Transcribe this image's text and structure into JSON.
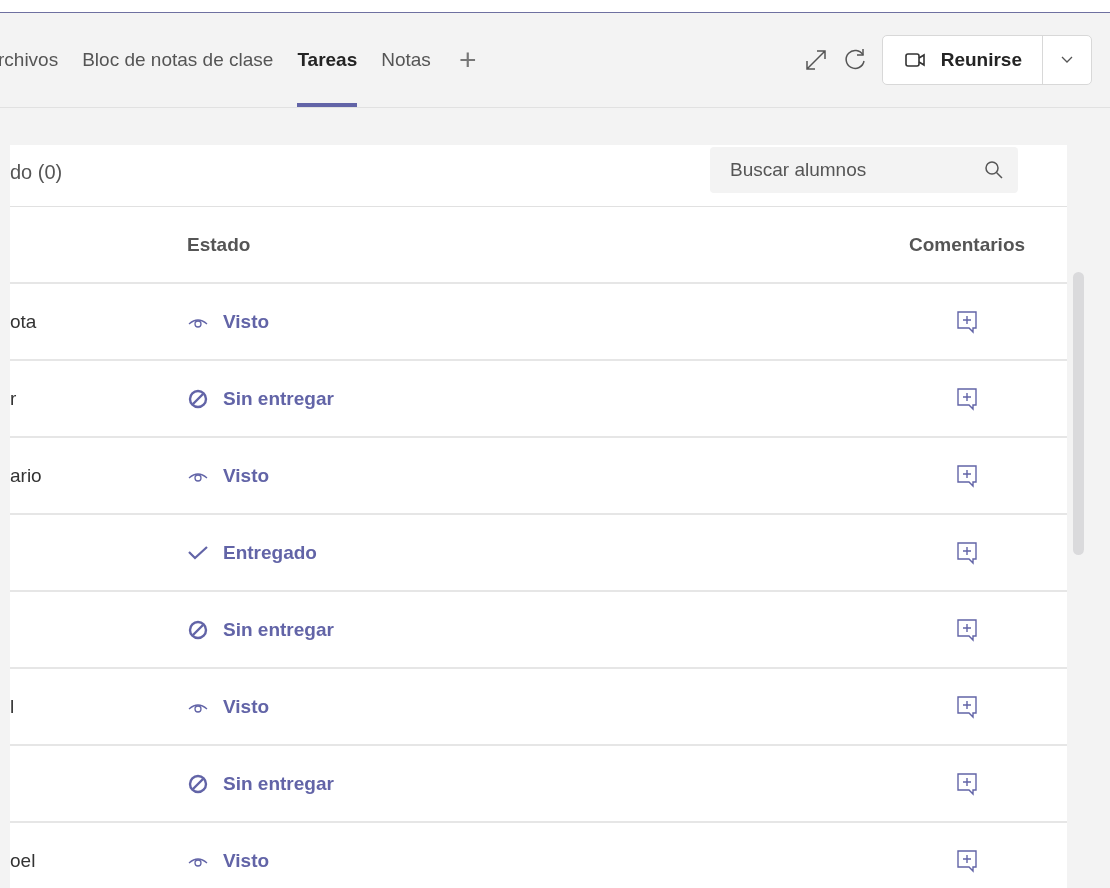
{
  "tabs": [
    {
      "label": "rchivos",
      "selected": false
    },
    {
      "label": "Bloc de notas de clase",
      "selected": false
    },
    {
      "label": "Tareas",
      "selected": true
    },
    {
      "label": "Notas",
      "selected": false
    }
  ],
  "add_tab": "+",
  "meet_button": {
    "label": "Reunirse"
  },
  "filter": {
    "label": "do (0)"
  },
  "search": {
    "placeholder": "Buscar alumnos"
  },
  "table": {
    "columns": [
      "Estado",
      "Comentarios"
    ],
    "rows": [
      {
        "column_1": "ota",
        "status": "Visto",
        "kind": "seen"
      },
      {
        "column_1": "r",
        "status": "Sin entregar",
        "kind": "missing"
      },
      {
        "column_1": "ario",
        "status": "Visto",
        "kind": "seen"
      },
      {
        "status": "Entregado",
        "kind": "submitted"
      },
      {
        "status": "Sin entregar",
        "kind": "missing"
      },
      {
        "column_1": "l",
        "status": "Visto",
        "kind": "seen"
      },
      {
        "status": "Sin entregar",
        "kind": "missing"
      },
      {
        "column_1": "oel",
        "status": "Visto",
        "kind": "seen"
      }
    ]
  }
}
